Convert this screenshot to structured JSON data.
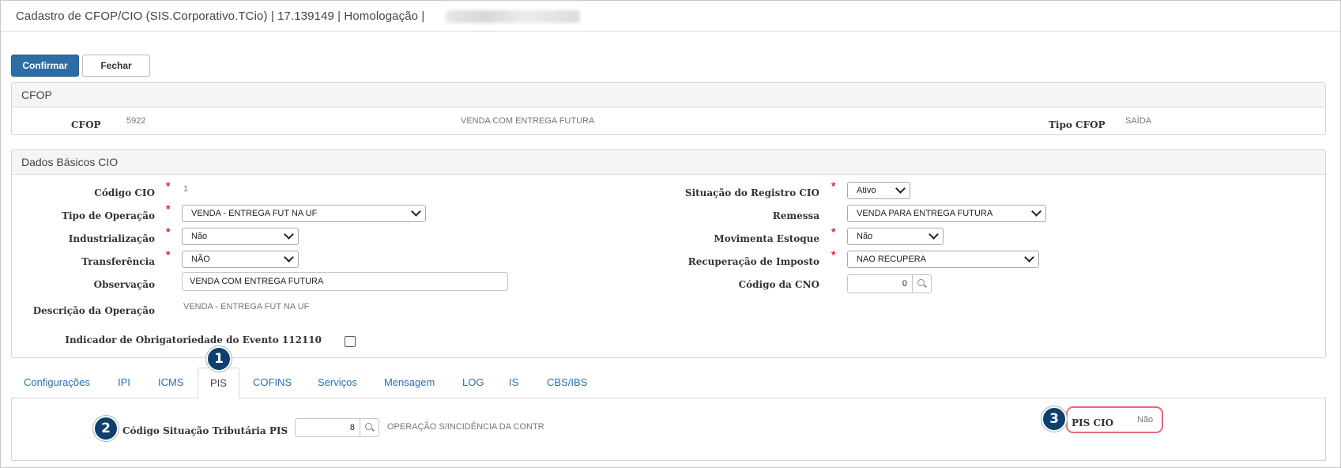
{
  "window": {
    "title": "Cadastro de CFOP/CIO (SIS.Corporativo.TCio) | 17.139149 | Homologação |"
  },
  "toolbar": {
    "confirm_label": "Confirmar",
    "close_label": "Fechar"
  },
  "cfop_panel": {
    "heading": "CFOP",
    "cfop_label": "CFOP",
    "cfop_code": "5922",
    "cfop_description": "VENDA COM ENTREGA FUTURA",
    "tipo_label": "Tipo CFOP",
    "tipo_value": "SAÍDA"
  },
  "basic_panel": {
    "heading": "Dados Básicos CIO",
    "codigo_cio": {
      "label": "Código CIO",
      "value": "1"
    },
    "tipo_operacao": {
      "label": "Tipo de Operação",
      "value": "VENDA - ENTREGA FUT NA UF"
    },
    "industrializacao": {
      "label": "Industrialização",
      "value": "Não"
    },
    "transferencia": {
      "label": "Transferência",
      "value": "NÃO"
    },
    "observacao": {
      "label": "Observação",
      "value": "VENDA COM ENTREGA FUTURA"
    },
    "descricao_operacao": {
      "label": "Descrição da Operação",
      "value": "VENDA - ENTREGA FUT NA UF"
    },
    "indicador": {
      "label": "Indicador de Obrigatoriedade do Evento 112110",
      "checked": false
    },
    "situacao_registro": {
      "label": "Situação do Registro CIO",
      "value": "Ativo"
    },
    "remessa": {
      "label": "Remessa",
      "value": "VENDA PARA ENTREGA FUTURA"
    },
    "movimenta_estoque": {
      "label": "Movimenta Estoque",
      "value": "Não"
    },
    "recuperacao_imposto": {
      "label": "Recuperação de Imposto",
      "value": "NAO RECUPERA"
    },
    "codigo_cno": {
      "label": "Código da CNO",
      "value": "0"
    },
    "required_marker": "*"
  },
  "tabs": [
    {
      "label": "Configurações",
      "active": false
    },
    {
      "label": "IPI",
      "active": false
    },
    {
      "label": "ICMS",
      "active": false
    },
    {
      "label": "PIS",
      "active": true
    },
    {
      "label": "COFINS",
      "active": false
    },
    {
      "label": "Serviços",
      "active": false
    },
    {
      "label": "Mensagem",
      "active": false
    },
    {
      "label": "LOG",
      "active": false
    },
    {
      "label": "IS",
      "active": false
    },
    {
      "label": "CBS/IBS",
      "active": false
    }
  ],
  "pis_tab": {
    "cst_label": "Código Situação Tributária PIS",
    "cst_value": "8",
    "cst_description": "OPERAÇÃO S/INCIDÊNCIA DA CONTR",
    "pis_cio_label": "PIS CIO",
    "pis_cio_value": "Não"
  },
  "annotations": {
    "marker_1": "1",
    "marker_2": "2",
    "marker_3": "3",
    "highlight_color": "#e86a75",
    "marker_color": "#0e3f6e"
  },
  "colors": {
    "primary_button": "#2e6da4",
    "tab_link": "#2a6fb0",
    "required": "#d9242a"
  }
}
